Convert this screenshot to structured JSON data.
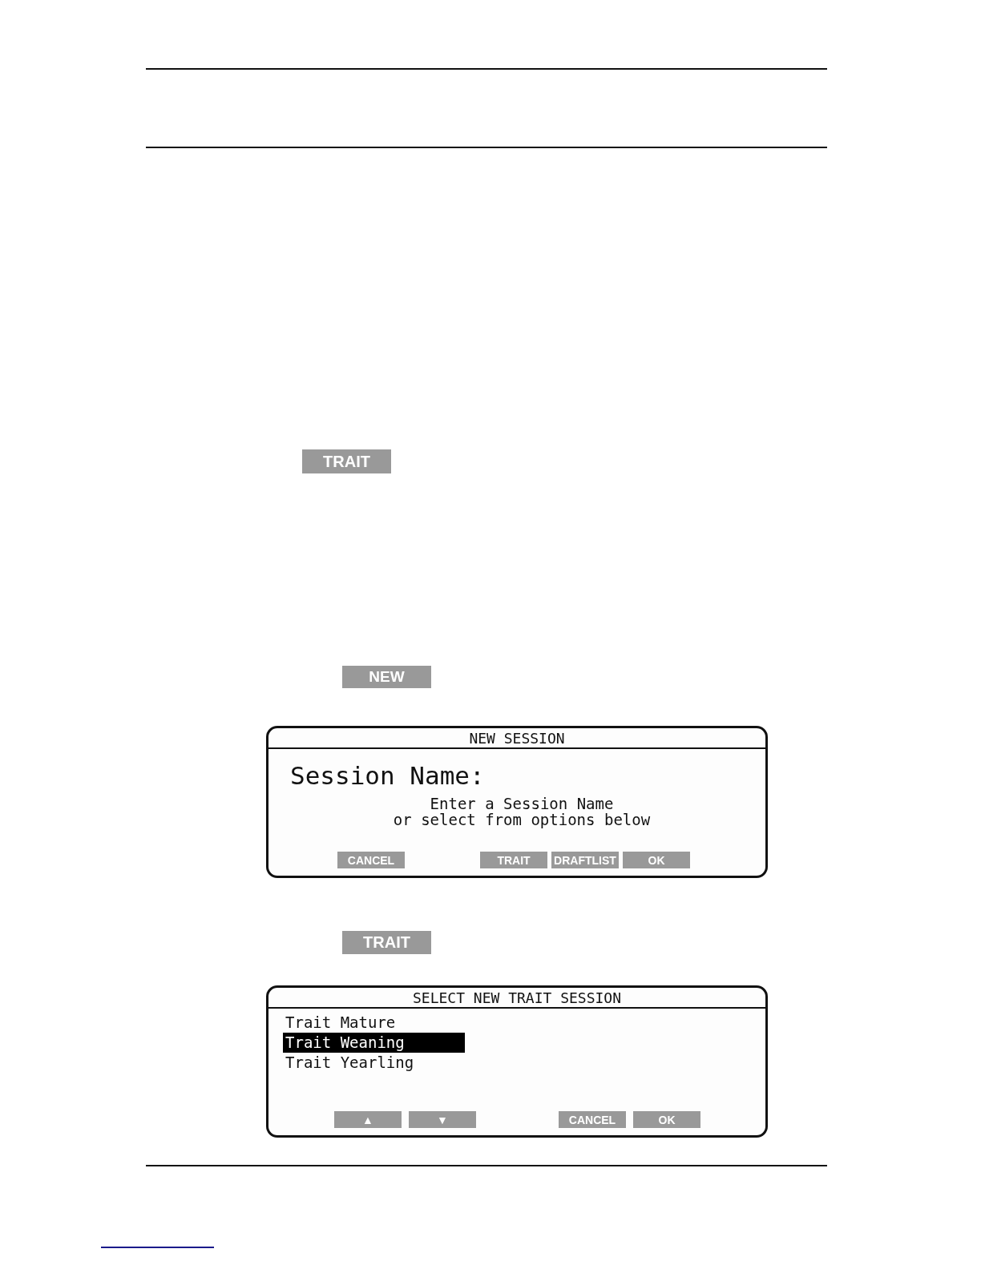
{
  "trait_button": {
    "label": "TRAIT"
  },
  "new_button": {
    "label": "NEW"
  },
  "new_session_dialog": {
    "title": "NEW SESSION",
    "heading": "Session Name:",
    "hint_lines": [
      "Enter a Session Name",
      "or select from options below"
    ],
    "buttons": [
      {
        "label": "CANCEL"
      },
      {
        "label": "TRAIT"
      },
      {
        "label": "DRAFTLIST"
      },
      {
        "label": "OK"
      }
    ]
  },
  "trait_button_2": {
    "label": "TRAIT"
  },
  "select_trait_dialog": {
    "title": "SELECT NEW TRAIT SESSION",
    "items": [
      {
        "label": "Trait Mature",
        "selected": false
      },
      {
        "label": "Trait Weaning",
        "selected": true
      },
      {
        "label": "Trait Yearling",
        "selected": false
      }
    ],
    "buttons": [
      {
        "label": "▲"
      },
      {
        "label": "▼"
      },
      {
        "label": "CANCEL"
      },
      {
        "label": "OK"
      }
    ]
  }
}
